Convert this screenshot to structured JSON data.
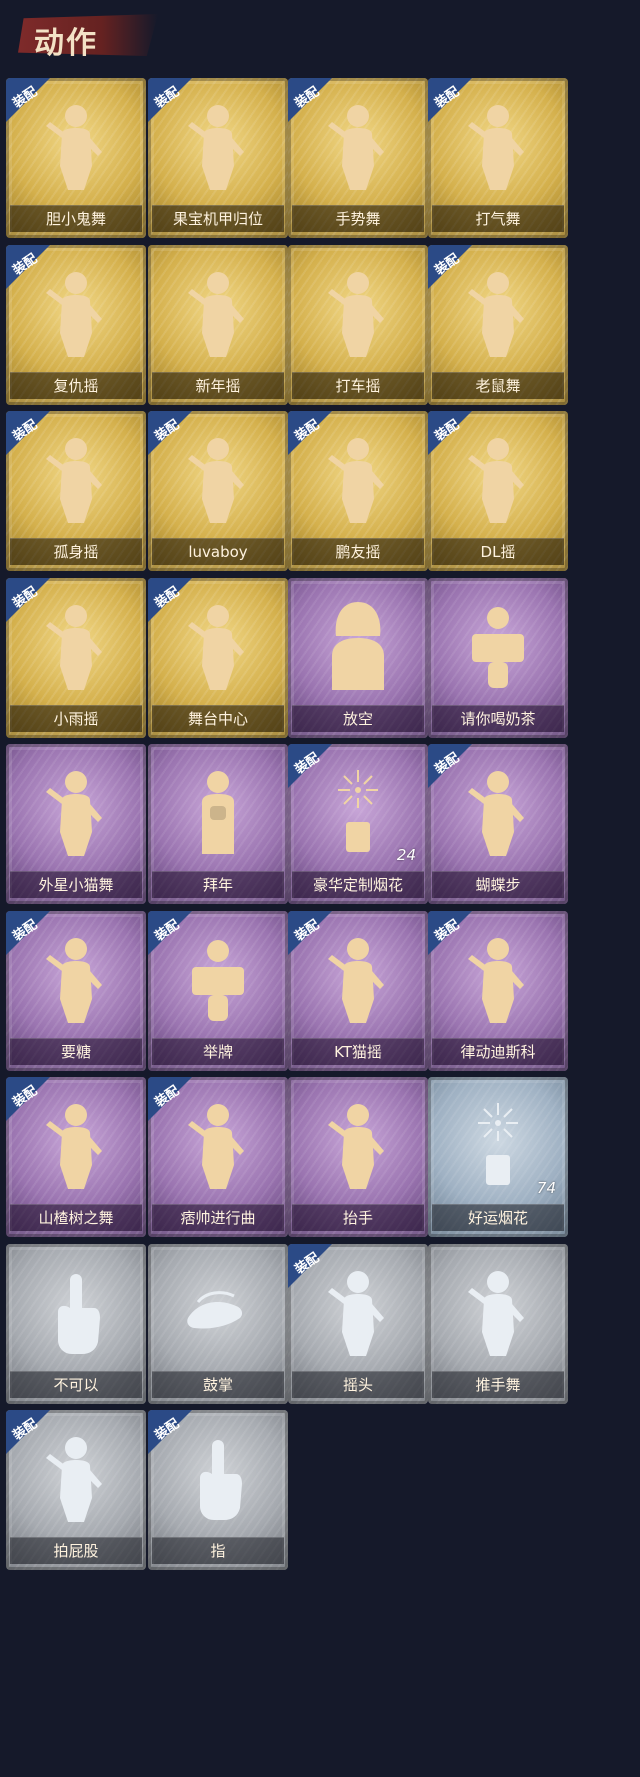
{
  "header": {
    "title": "动作"
  },
  "equip_label": "装配",
  "items": [
    {
      "name": "胆小鬼舞",
      "rarity": "gold",
      "equipped": true,
      "figure": "dance-figure-icon"
    },
    {
      "name": "果宝机甲归位",
      "rarity": "gold",
      "equipped": true,
      "figure": "dance-figure-icon"
    },
    {
      "name": "手势舞",
      "rarity": "gold",
      "equipped": true,
      "figure": "dance-figure-icon"
    },
    {
      "name": "打气舞",
      "rarity": "gold",
      "equipped": true,
      "figure": "dance-figure-icon"
    },
    {
      "name": "复仇摇",
      "rarity": "gold",
      "equipped": true,
      "figure": "dance-figure-icon"
    },
    {
      "name": "新年摇",
      "rarity": "gold",
      "equipped": false,
      "figure": "dance-figure-icon"
    },
    {
      "name": "打车摇",
      "rarity": "gold",
      "equipped": false,
      "figure": "dance-figure-icon"
    },
    {
      "name": "老鼠舞",
      "rarity": "gold",
      "equipped": true,
      "figure": "dance-figure-icon"
    },
    {
      "name": "孤身摇",
      "rarity": "gold",
      "equipped": true,
      "figure": "dance-figure-icon"
    },
    {
      "name": "luvaboy",
      "rarity": "gold",
      "equipped": true,
      "figure": "dance-figure-icon"
    },
    {
      "name": "鹏友摇",
      "rarity": "gold",
      "equipped": true,
      "figure": "dance-figure-icon"
    },
    {
      "name": "DL摇",
      "rarity": "gold",
      "equipped": true,
      "figure": "dance-figure-icon"
    },
    {
      "name": "小雨摇",
      "rarity": "gold",
      "equipped": true,
      "figure": "dance-figure-icon"
    },
    {
      "name": "舞台中心",
      "rarity": "gold",
      "equipped": true,
      "figure": "dance-figure-icon"
    },
    {
      "name": "放空",
      "rarity": "purple",
      "equipped": false,
      "figure": "hooded-figure-icon"
    },
    {
      "name": "请你喝奶茶",
      "rarity": "purple",
      "equipped": false,
      "figure": "sign-figure-icon"
    },
    {
      "name": "外星小猫舞",
      "rarity": "purple",
      "equipped": false,
      "figure": "dance-figure-icon"
    },
    {
      "name": "拜年",
      "rarity": "purple",
      "equipped": false,
      "figure": "bow-figure-icon"
    },
    {
      "name": "豪华定制烟花",
      "rarity": "purple",
      "equipped": true,
      "figure": "fireworks-icon",
      "count": "24"
    },
    {
      "name": "蝴蝶步",
      "rarity": "purple",
      "equipped": true,
      "figure": "dance-figure-icon"
    },
    {
      "name": "要糖",
      "rarity": "purple",
      "equipped": true,
      "figure": "dance-figure-icon"
    },
    {
      "name": "举牌",
      "rarity": "purple",
      "equipped": true,
      "figure": "sign-figure-icon"
    },
    {
      "name": "KT猫摇",
      "rarity": "purple",
      "equipped": true,
      "figure": "dance-figure-icon"
    },
    {
      "name": "律动迪斯科",
      "rarity": "purple",
      "equipped": true,
      "figure": "dance-figure-icon"
    },
    {
      "name": "山楂树之舞",
      "rarity": "purple",
      "equipped": true,
      "figure": "dance-figure-icon"
    },
    {
      "name": "痞帅进行曲",
      "rarity": "purple",
      "equipped": true,
      "figure": "dance-figure-icon"
    },
    {
      "name": "抬手",
      "rarity": "purple",
      "equipped": false,
      "figure": "dance-figure-icon"
    },
    {
      "name": "好运烟花",
      "rarity": "blue",
      "equipped": false,
      "figure": "fireworks-icon",
      "count": "74"
    },
    {
      "name": "不可以",
      "rarity": "grey",
      "equipped": false,
      "figure": "hand-icon"
    },
    {
      "name": "鼓掌",
      "rarity": "grey",
      "equipped": false,
      "figure": "clap-icon"
    },
    {
      "name": "摇头",
      "rarity": "grey",
      "equipped": true,
      "figure": "dance-figure-icon"
    },
    {
      "name": "推手舞",
      "rarity": "grey",
      "equipped": false,
      "figure": "dance-figure-icon"
    },
    {
      "name": "拍屁股",
      "rarity": "grey",
      "equipped": true,
      "figure": "dance-figure-icon"
    },
    {
      "name": "指",
      "rarity": "grey",
      "equipped": true,
      "figure": "hand-icon"
    }
  ]
}
